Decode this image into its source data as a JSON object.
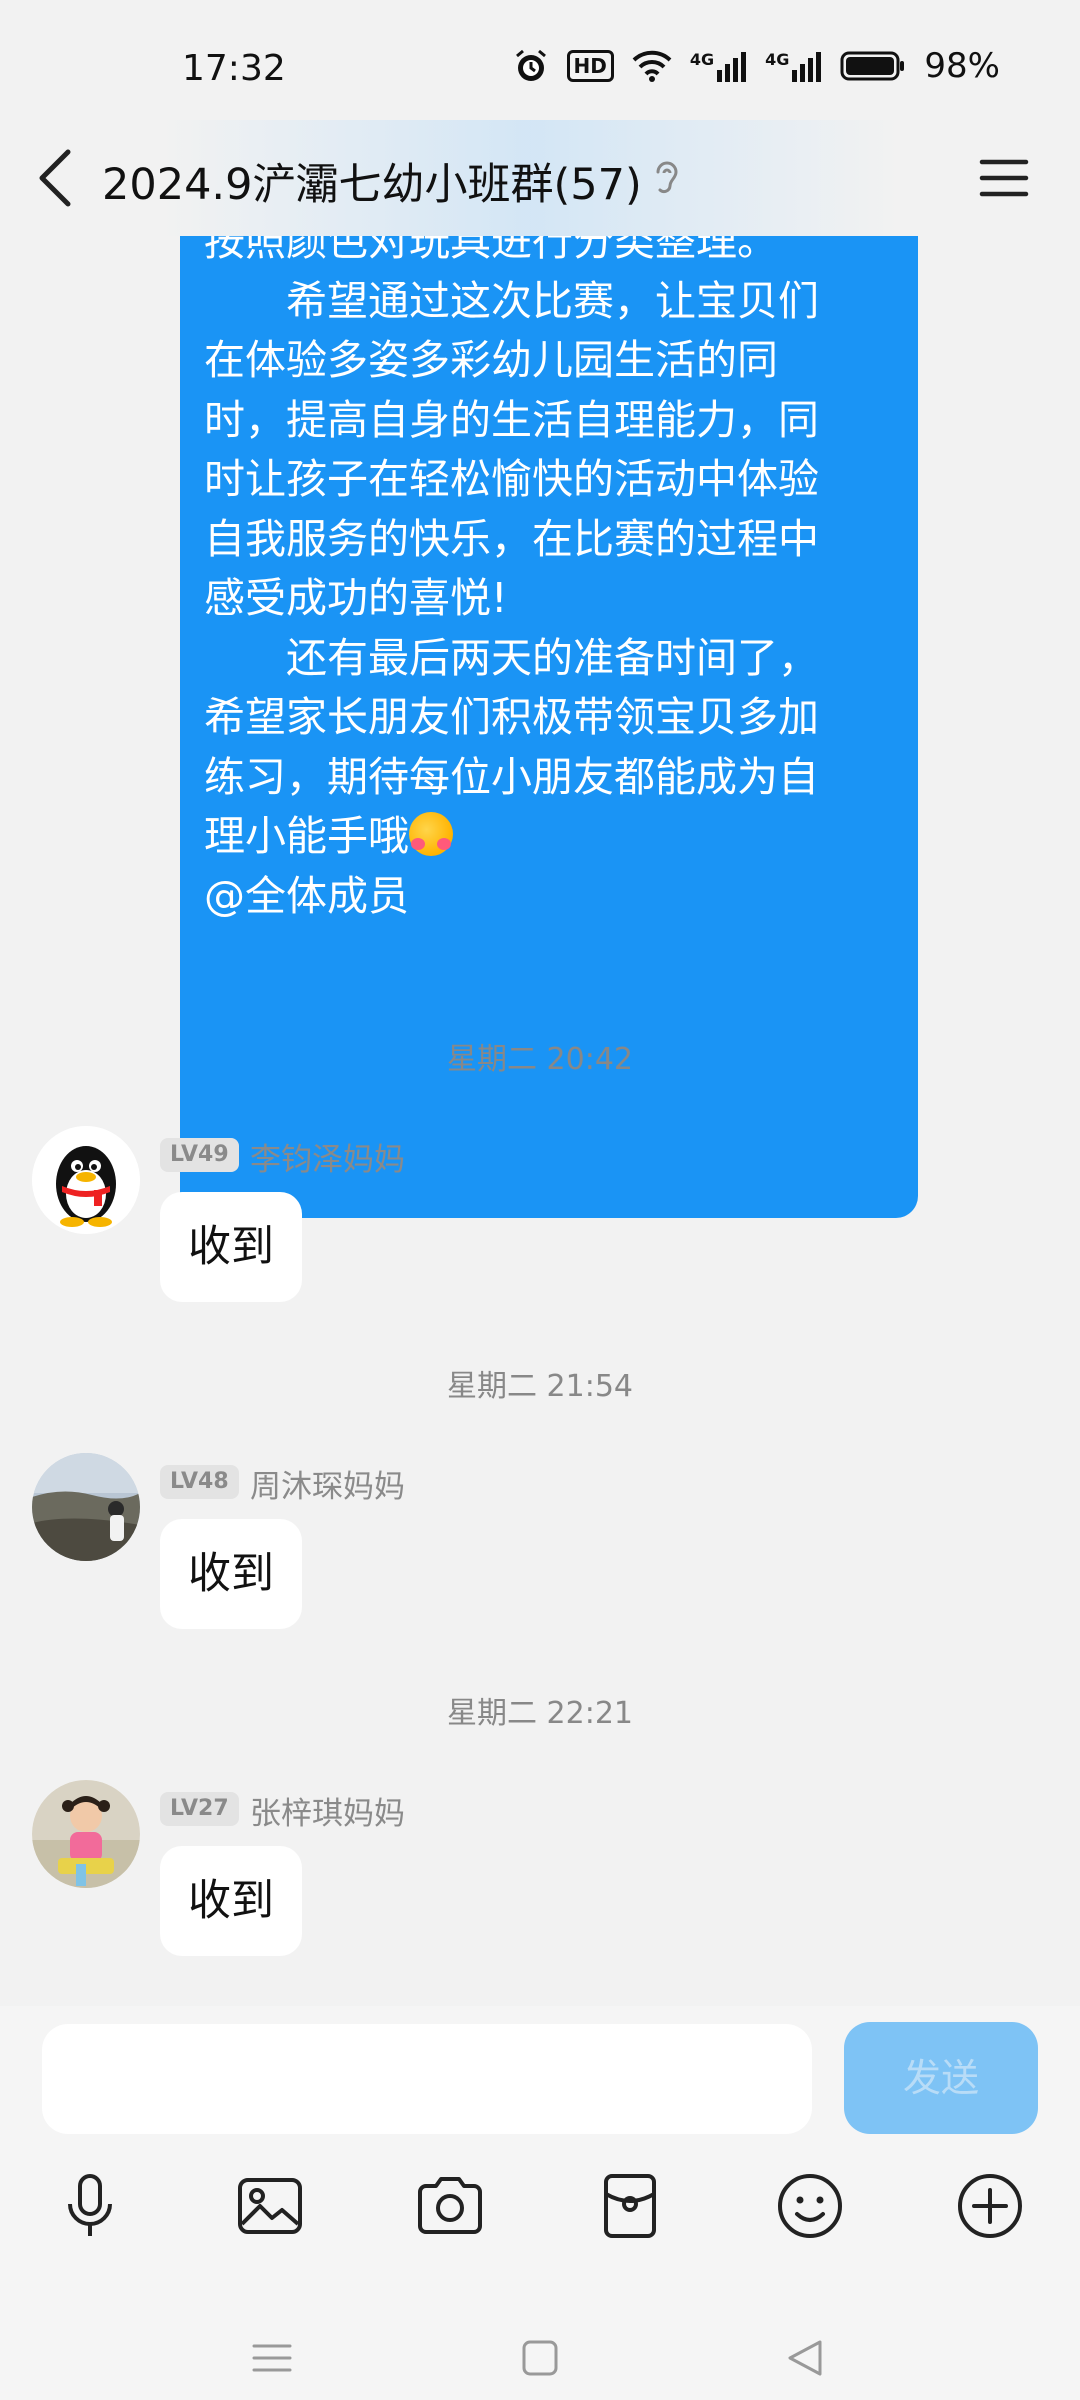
{
  "status_bar": {
    "time": "17:32",
    "battery": "98%",
    "hd_label": "HD",
    "net1": "4G",
    "net2": "4G"
  },
  "header": {
    "title": "2024.9浐灞七幼小班群(57)"
  },
  "announcement": {
    "lines": [
      "按照颜色对玩具进行分类整理。",
      "　　希望通过这次比赛，让宝贝们",
      "在体验多姿多彩幼儿园生活的同",
      "时，提高自身的生活自理能力，同",
      "时让孩子在轻松愉快的活动中体验",
      "自我服务的快乐，在比赛的过程中",
      "感受成功的喜悦!",
      "　　还有最后两天的准备时间了，",
      "希望家长朋友们积极带领宝贝多加",
      "练习，期待每位小朋友都能成为自",
      "理小能手哦",
      "@全体成员"
    ]
  },
  "messages": [
    {
      "timestamp": "星期二 20:42",
      "level": "LV49",
      "sender": "李钧泽妈妈",
      "text": "收到",
      "avatar": "qq-penguin-avatar"
    },
    {
      "timestamp": "星期二 21:54",
      "level": "LV48",
      "sender": "周沐琛妈妈",
      "text": "收到",
      "avatar": "landscape-photo-avatar"
    },
    {
      "timestamp": "星期二 22:21",
      "level": "LV27",
      "sender": "张梓琪妈妈",
      "text": "收到",
      "avatar": "child-photo-avatar"
    }
  ],
  "input": {
    "placeholder": "",
    "send_label": "发送"
  },
  "toolbar": [
    "microphone-icon",
    "image-icon",
    "camera-icon",
    "red-packet-icon",
    "emoji-icon",
    "plus-icon"
  ],
  "colors": {
    "bubble_self": "#1a94f5",
    "send_button": "#7ec3f5",
    "background": "#f2f2f2"
  }
}
